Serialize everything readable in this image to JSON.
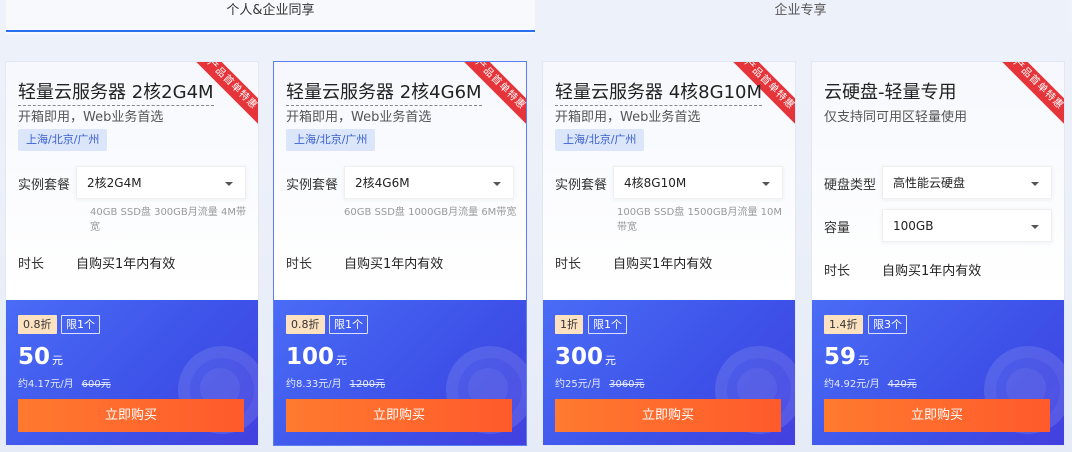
{
  "tabs": [
    {
      "label": "个人&企业同享",
      "active": true
    },
    {
      "label": "企业专享",
      "active": false
    }
  ],
  "ribbon_text": "产品首单特惠",
  "cards": [
    {
      "title": "轻量云服务器 2核2G4M",
      "subtitle": "开箱即用，Web业务首选",
      "region": "上海/北京/广州",
      "package_label": "实例套餐",
      "package_value": "2核2G4M",
      "package_desc": "40GB SSD盘 300GB月流量 4M带宽",
      "duration_label": "时长",
      "duration_value": "自购买1年内有效",
      "discount": "0.8折",
      "limit": "限1个",
      "price": "50",
      "price_unit": "元",
      "monthly": "约4.17元/月",
      "original": "600元",
      "buy_label": "立即购买"
    },
    {
      "title": "轻量云服务器 2核4G6M",
      "subtitle": "开箱即用，Web业务首选",
      "region": "上海/北京/广州",
      "package_label": "实例套餐",
      "package_value": "2核4G6M",
      "package_desc": "60GB SSD盘 1000GB月流量 6M带宽",
      "duration_label": "时长",
      "duration_value": "自购买1年内有效",
      "discount": "0.8折",
      "limit": "限1个",
      "price": "100",
      "price_unit": "元",
      "monthly": "约8.33元/月",
      "original": "1200元",
      "buy_label": "立即购买"
    },
    {
      "title": "轻量云服务器 4核8G10M",
      "subtitle": "开箱即用，Web业务首选",
      "region": "上海/北京/广州",
      "package_label": "实例套餐",
      "package_value": "4核8G10M",
      "package_desc": "100GB SSD盘 1500GB月流量 10M带宽",
      "duration_label": "时长",
      "duration_value": "自购买1年内有效",
      "discount": "1折",
      "limit": "限1个",
      "price": "300",
      "price_unit": "元",
      "monthly": "约25元/月",
      "original": "3060元",
      "buy_label": "立即购买"
    },
    {
      "title": "云硬盘-轻量专用",
      "subtitle": "仅支持同可用区轻量使用",
      "disk_type_label": "硬盘类型",
      "disk_type_value": "高性能云硬盘",
      "capacity_label": "容量",
      "capacity_value": "100GB",
      "duration_label": "时长",
      "duration_value": "自购买1年内有效",
      "discount": "1.4折",
      "limit": "限3个",
      "price": "59",
      "price_unit": "元",
      "monthly": "约4.92元/月",
      "original": "420元",
      "buy_label": "立即购买"
    }
  ],
  "colors": {
    "accent": "#2a6ff0",
    "price_block": "#4357ea",
    "buy_button": "#ff6a2d",
    "ribbon": "#e6353a",
    "discount_badge": "#fde2c2"
  }
}
